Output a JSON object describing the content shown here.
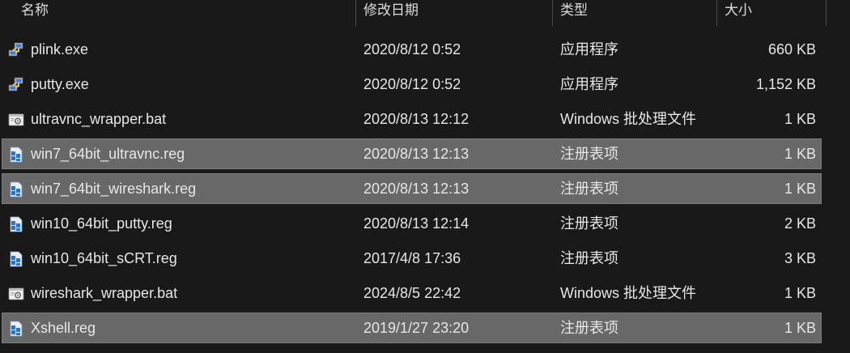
{
  "columns": {
    "name": "名称",
    "date": "修改日期",
    "type": "类型",
    "size": "大小"
  },
  "files": [
    {
      "name": "plink.exe",
      "date": "2020/8/12 0:52",
      "type": "应用程序",
      "size": "660 KB",
      "icon": "putty-app-icon",
      "selected": false
    },
    {
      "name": "putty.exe",
      "date": "2020/8/12 0:52",
      "type": "应用程序",
      "size": "1,152 KB",
      "icon": "putty-app-icon",
      "selected": false
    },
    {
      "name": "ultravnc_wrapper.bat",
      "date": "2020/8/13 12:12",
      "type": "Windows 批处理文件",
      "size": "1 KB",
      "icon": "batch-file-icon",
      "selected": false
    },
    {
      "name": "win7_64bit_ultravnc.reg",
      "date": "2020/8/13 12:13",
      "type": "注册表项",
      "size": "1 KB",
      "icon": "registry-file-icon",
      "selected": true
    },
    {
      "name": "win7_64bit_wireshark.reg",
      "date": "2020/8/13 12:13",
      "type": "注册表项",
      "size": "1 KB",
      "icon": "registry-file-icon",
      "selected": true
    },
    {
      "name": "win10_64bit_putty.reg",
      "date": "2020/8/13 12:14",
      "type": "注册表项",
      "size": "2 KB",
      "icon": "registry-file-icon",
      "selected": false
    },
    {
      "name": "win10_64bit_sCRT.reg",
      "date": "2017/4/8 17:36",
      "type": "注册表项",
      "size": "3 KB",
      "icon": "registry-file-icon",
      "selected": false
    },
    {
      "name": "wireshark_wrapper.bat",
      "date": "2024/8/5 22:42",
      "type": "Windows 批处理文件",
      "size": "1 KB",
      "icon": "batch-file-icon",
      "selected": false
    },
    {
      "name": "Xshell.reg",
      "date": "2019/1/27 23:20",
      "type": "注册表项",
      "size": "1 KB",
      "icon": "registry-file-icon",
      "selected": true
    }
  ],
  "colors": {
    "background": "#191919",
    "selected_row": "#686868",
    "text": "#e6e6e6"
  }
}
